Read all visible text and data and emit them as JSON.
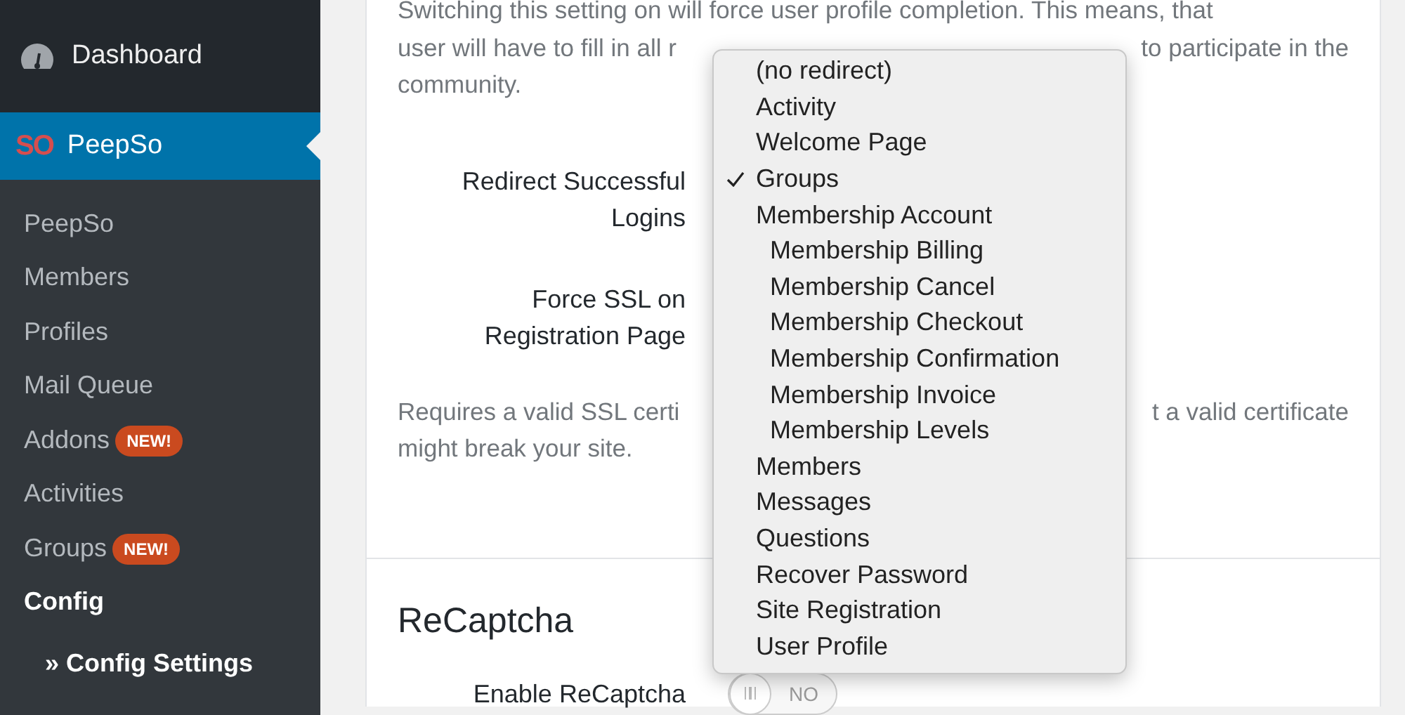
{
  "sidebar": {
    "dashboard": {
      "label": "Dashboard"
    },
    "active_menu": {
      "logo": "SO",
      "label": "PeepSo",
      "selected": true
    },
    "submenu": [
      {
        "label": "PeepSo",
        "selected": false
      },
      {
        "label": "Members",
        "selected": false
      },
      {
        "label": "Profiles",
        "selected": false
      },
      {
        "label": "Mail Queue",
        "selected": false
      },
      {
        "label": "Addons",
        "badge": "NEW!",
        "selected": false
      },
      {
        "label": "Activities",
        "selected": false
      },
      {
        "label": "Groups",
        "badge": "NEW!",
        "selected": false
      },
      {
        "label": "Config",
        "selected": true,
        "children": [
          {
            "label": "» Config Settings",
            "selected": true
          }
        ]
      }
    ]
  },
  "main": {
    "description_1": {
      "lines": [
        [
          "Switching this setting on will force user profile completion. This means, that"
        ],
        [
          "user will have to fill in all r",
          "to participate in the"
        ],
        [
          "community."
        ]
      ]
    },
    "settings": [
      {
        "label": "Redirect Successful Logins"
      },
      {
        "label": "Force SSL on Registration Page"
      }
    ],
    "description_2": {
      "lines": [
        [
          "Requires a valid SSL certi",
          "t a valid certificate"
        ],
        [
          "might break your site."
        ]
      ]
    },
    "sections": [
      {
        "title": "ReCaptcha",
        "settings": [
          {
            "label": "Enable ReCaptcha",
            "kind": "toggle",
            "on": false,
            "value": "NO"
          }
        ]
      }
    ]
  },
  "dropdown": {
    "options": [
      {
        "label": "(no redirect)",
        "selected": false
      },
      {
        "label": "Activity",
        "selected": false
      },
      {
        "label": "Welcome Page",
        "selected": false
      },
      {
        "label": "Groups",
        "selected": true
      },
      {
        "label": "Membership Account",
        "selected": false,
        "children": [
          {
            "label": "Membership Billing",
            "selected": false
          },
          {
            "label": "Membership Cancel",
            "selected": false
          },
          {
            "label": "Membership Checkout",
            "selected": false
          },
          {
            "label": "Membership Confirmation",
            "selected": false
          },
          {
            "label": "Membership Invoice",
            "selected": false
          },
          {
            "label": "Membership Levels",
            "selected": false
          }
        ]
      },
      {
        "label": "Members",
        "selected": false
      },
      {
        "label": "Messages",
        "selected": false
      },
      {
        "label": "Questions",
        "selected": false
      },
      {
        "label": "Recover Password",
        "selected": false
      },
      {
        "label": "Site Registration",
        "selected": false
      },
      {
        "label": "User Profile",
        "selected": false
      }
    ]
  }
}
